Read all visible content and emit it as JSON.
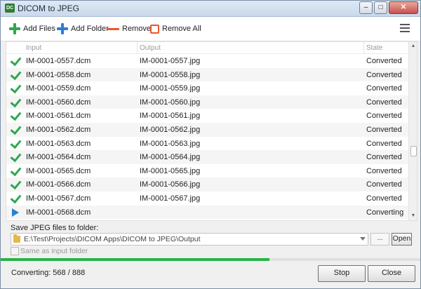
{
  "window": {
    "title": "DICOM to JPEG",
    "app_icon": "dicom-app-icon"
  },
  "window_controls": {
    "minimize": "–",
    "maximize": "□",
    "close": "✕"
  },
  "toolbar": {
    "add_files": "Add Files",
    "add_folder": "Add Folder",
    "remove": "Remove",
    "remove_all": "Remove All",
    "colors": {
      "add": "#2fa84f",
      "add_folder": "#2a7fd4",
      "remove": "#e8592a"
    }
  },
  "table": {
    "headers": {
      "input": "Input",
      "output": "Output",
      "state": "State"
    },
    "rows": [
      {
        "input": "IM-0001-0557.dcm",
        "output": "IM-0001-0557.jpg",
        "state": "Converted",
        "icon": "check-icon"
      },
      {
        "input": "IM-0001-0558.dcm",
        "output": "IM-0001-0558.jpg",
        "state": "Converted",
        "icon": "check-icon"
      },
      {
        "input": "IM-0001-0559.dcm",
        "output": "IM-0001-0559.jpg",
        "state": "Converted",
        "icon": "check-icon"
      },
      {
        "input": "IM-0001-0560.dcm",
        "output": "IM-0001-0560.jpg",
        "state": "Converted",
        "icon": "check-icon"
      },
      {
        "input": "IM-0001-0561.dcm",
        "output": "IM-0001-0561.jpg",
        "state": "Converted",
        "icon": "check-icon"
      },
      {
        "input": "IM-0001-0562.dcm",
        "output": "IM-0001-0562.jpg",
        "state": "Converted",
        "icon": "check-icon"
      },
      {
        "input": "IM-0001-0563.dcm",
        "output": "IM-0001-0563.jpg",
        "state": "Converted",
        "icon": "check-icon"
      },
      {
        "input": "IM-0001-0564.dcm",
        "output": "IM-0001-0564.jpg",
        "state": "Converted",
        "icon": "check-icon"
      },
      {
        "input": "IM-0001-0565.dcm",
        "output": "IM-0001-0565.jpg",
        "state": "Converted",
        "icon": "check-icon"
      },
      {
        "input": "IM-0001-0566.dcm",
        "output": "IM-0001-0566.jpg",
        "state": "Converted",
        "icon": "check-icon"
      },
      {
        "input": "IM-0001-0567.dcm",
        "output": "IM-0001-0567.jpg",
        "state": "Converted",
        "icon": "check-icon"
      },
      {
        "input": "IM-0001-0568.dcm",
        "output": "",
        "state": "Converting",
        "icon": "play-icon"
      }
    ]
  },
  "save": {
    "label": "Save JPEG files to folder:",
    "path": "E:\\Test\\Projects\\DICOM Apps\\DICOM to JPEG\\Output",
    "browse": "...",
    "open": "Open",
    "same_as_input": "Same as input folder",
    "same_as_input_checked": false
  },
  "status": {
    "text": "Converting: 568 / 888",
    "progress": 0.64
  },
  "buttons": {
    "stop": "Stop",
    "close": "Close"
  }
}
